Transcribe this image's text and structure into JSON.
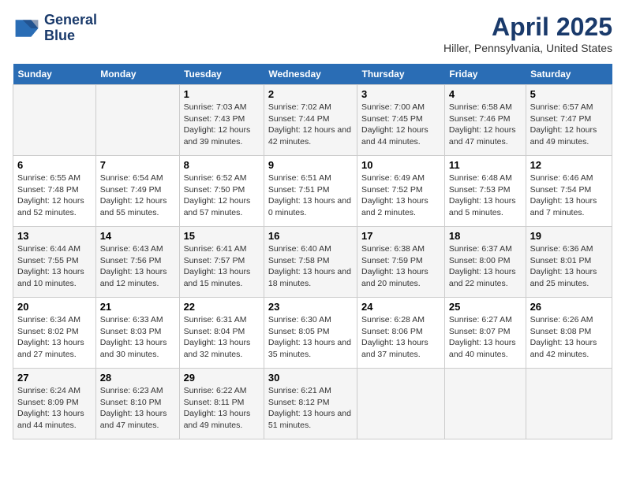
{
  "header": {
    "logo_line1": "General",
    "logo_line2": "Blue",
    "title": "April 2025",
    "subtitle": "Hiller, Pennsylvania, United States"
  },
  "weekdays": [
    "Sunday",
    "Monday",
    "Tuesday",
    "Wednesday",
    "Thursday",
    "Friday",
    "Saturday"
  ],
  "weeks": [
    [
      {
        "day": "",
        "info": ""
      },
      {
        "day": "",
        "info": ""
      },
      {
        "day": "1",
        "info": "Sunrise: 7:03 AM\nSunset: 7:43 PM\nDaylight: 12 hours and 39 minutes."
      },
      {
        "day": "2",
        "info": "Sunrise: 7:02 AM\nSunset: 7:44 PM\nDaylight: 12 hours and 42 minutes."
      },
      {
        "day": "3",
        "info": "Sunrise: 7:00 AM\nSunset: 7:45 PM\nDaylight: 12 hours and 44 minutes."
      },
      {
        "day": "4",
        "info": "Sunrise: 6:58 AM\nSunset: 7:46 PM\nDaylight: 12 hours and 47 minutes."
      },
      {
        "day": "5",
        "info": "Sunrise: 6:57 AM\nSunset: 7:47 PM\nDaylight: 12 hours and 49 minutes."
      }
    ],
    [
      {
        "day": "6",
        "info": "Sunrise: 6:55 AM\nSunset: 7:48 PM\nDaylight: 12 hours and 52 minutes."
      },
      {
        "day": "7",
        "info": "Sunrise: 6:54 AM\nSunset: 7:49 PM\nDaylight: 12 hours and 55 minutes."
      },
      {
        "day": "8",
        "info": "Sunrise: 6:52 AM\nSunset: 7:50 PM\nDaylight: 12 hours and 57 minutes."
      },
      {
        "day": "9",
        "info": "Sunrise: 6:51 AM\nSunset: 7:51 PM\nDaylight: 13 hours and 0 minutes."
      },
      {
        "day": "10",
        "info": "Sunrise: 6:49 AM\nSunset: 7:52 PM\nDaylight: 13 hours and 2 minutes."
      },
      {
        "day": "11",
        "info": "Sunrise: 6:48 AM\nSunset: 7:53 PM\nDaylight: 13 hours and 5 minutes."
      },
      {
        "day": "12",
        "info": "Sunrise: 6:46 AM\nSunset: 7:54 PM\nDaylight: 13 hours and 7 minutes."
      }
    ],
    [
      {
        "day": "13",
        "info": "Sunrise: 6:44 AM\nSunset: 7:55 PM\nDaylight: 13 hours and 10 minutes."
      },
      {
        "day": "14",
        "info": "Sunrise: 6:43 AM\nSunset: 7:56 PM\nDaylight: 13 hours and 12 minutes."
      },
      {
        "day": "15",
        "info": "Sunrise: 6:41 AM\nSunset: 7:57 PM\nDaylight: 13 hours and 15 minutes."
      },
      {
        "day": "16",
        "info": "Sunrise: 6:40 AM\nSunset: 7:58 PM\nDaylight: 13 hours and 18 minutes."
      },
      {
        "day": "17",
        "info": "Sunrise: 6:38 AM\nSunset: 7:59 PM\nDaylight: 13 hours and 20 minutes."
      },
      {
        "day": "18",
        "info": "Sunrise: 6:37 AM\nSunset: 8:00 PM\nDaylight: 13 hours and 22 minutes."
      },
      {
        "day": "19",
        "info": "Sunrise: 6:36 AM\nSunset: 8:01 PM\nDaylight: 13 hours and 25 minutes."
      }
    ],
    [
      {
        "day": "20",
        "info": "Sunrise: 6:34 AM\nSunset: 8:02 PM\nDaylight: 13 hours and 27 minutes."
      },
      {
        "day": "21",
        "info": "Sunrise: 6:33 AM\nSunset: 8:03 PM\nDaylight: 13 hours and 30 minutes."
      },
      {
        "day": "22",
        "info": "Sunrise: 6:31 AM\nSunset: 8:04 PM\nDaylight: 13 hours and 32 minutes."
      },
      {
        "day": "23",
        "info": "Sunrise: 6:30 AM\nSunset: 8:05 PM\nDaylight: 13 hours and 35 minutes."
      },
      {
        "day": "24",
        "info": "Sunrise: 6:28 AM\nSunset: 8:06 PM\nDaylight: 13 hours and 37 minutes."
      },
      {
        "day": "25",
        "info": "Sunrise: 6:27 AM\nSunset: 8:07 PM\nDaylight: 13 hours and 40 minutes."
      },
      {
        "day": "26",
        "info": "Sunrise: 6:26 AM\nSunset: 8:08 PM\nDaylight: 13 hours and 42 minutes."
      }
    ],
    [
      {
        "day": "27",
        "info": "Sunrise: 6:24 AM\nSunset: 8:09 PM\nDaylight: 13 hours and 44 minutes."
      },
      {
        "day": "28",
        "info": "Sunrise: 6:23 AM\nSunset: 8:10 PM\nDaylight: 13 hours and 47 minutes."
      },
      {
        "day": "29",
        "info": "Sunrise: 6:22 AM\nSunset: 8:11 PM\nDaylight: 13 hours and 49 minutes."
      },
      {
        "day": "30",
        "info": "Sunrise: 6:21 AM\nSunset: 8:12 PM\nDaylight: 13 hours and 51 minutes."
      },
      {
        "day": "",
        "info": ""
      },
      {
        "day": "",
        "info": ""
      },
      {
        "day": "",
        "info": ""
      }
    ]
  ]
}
